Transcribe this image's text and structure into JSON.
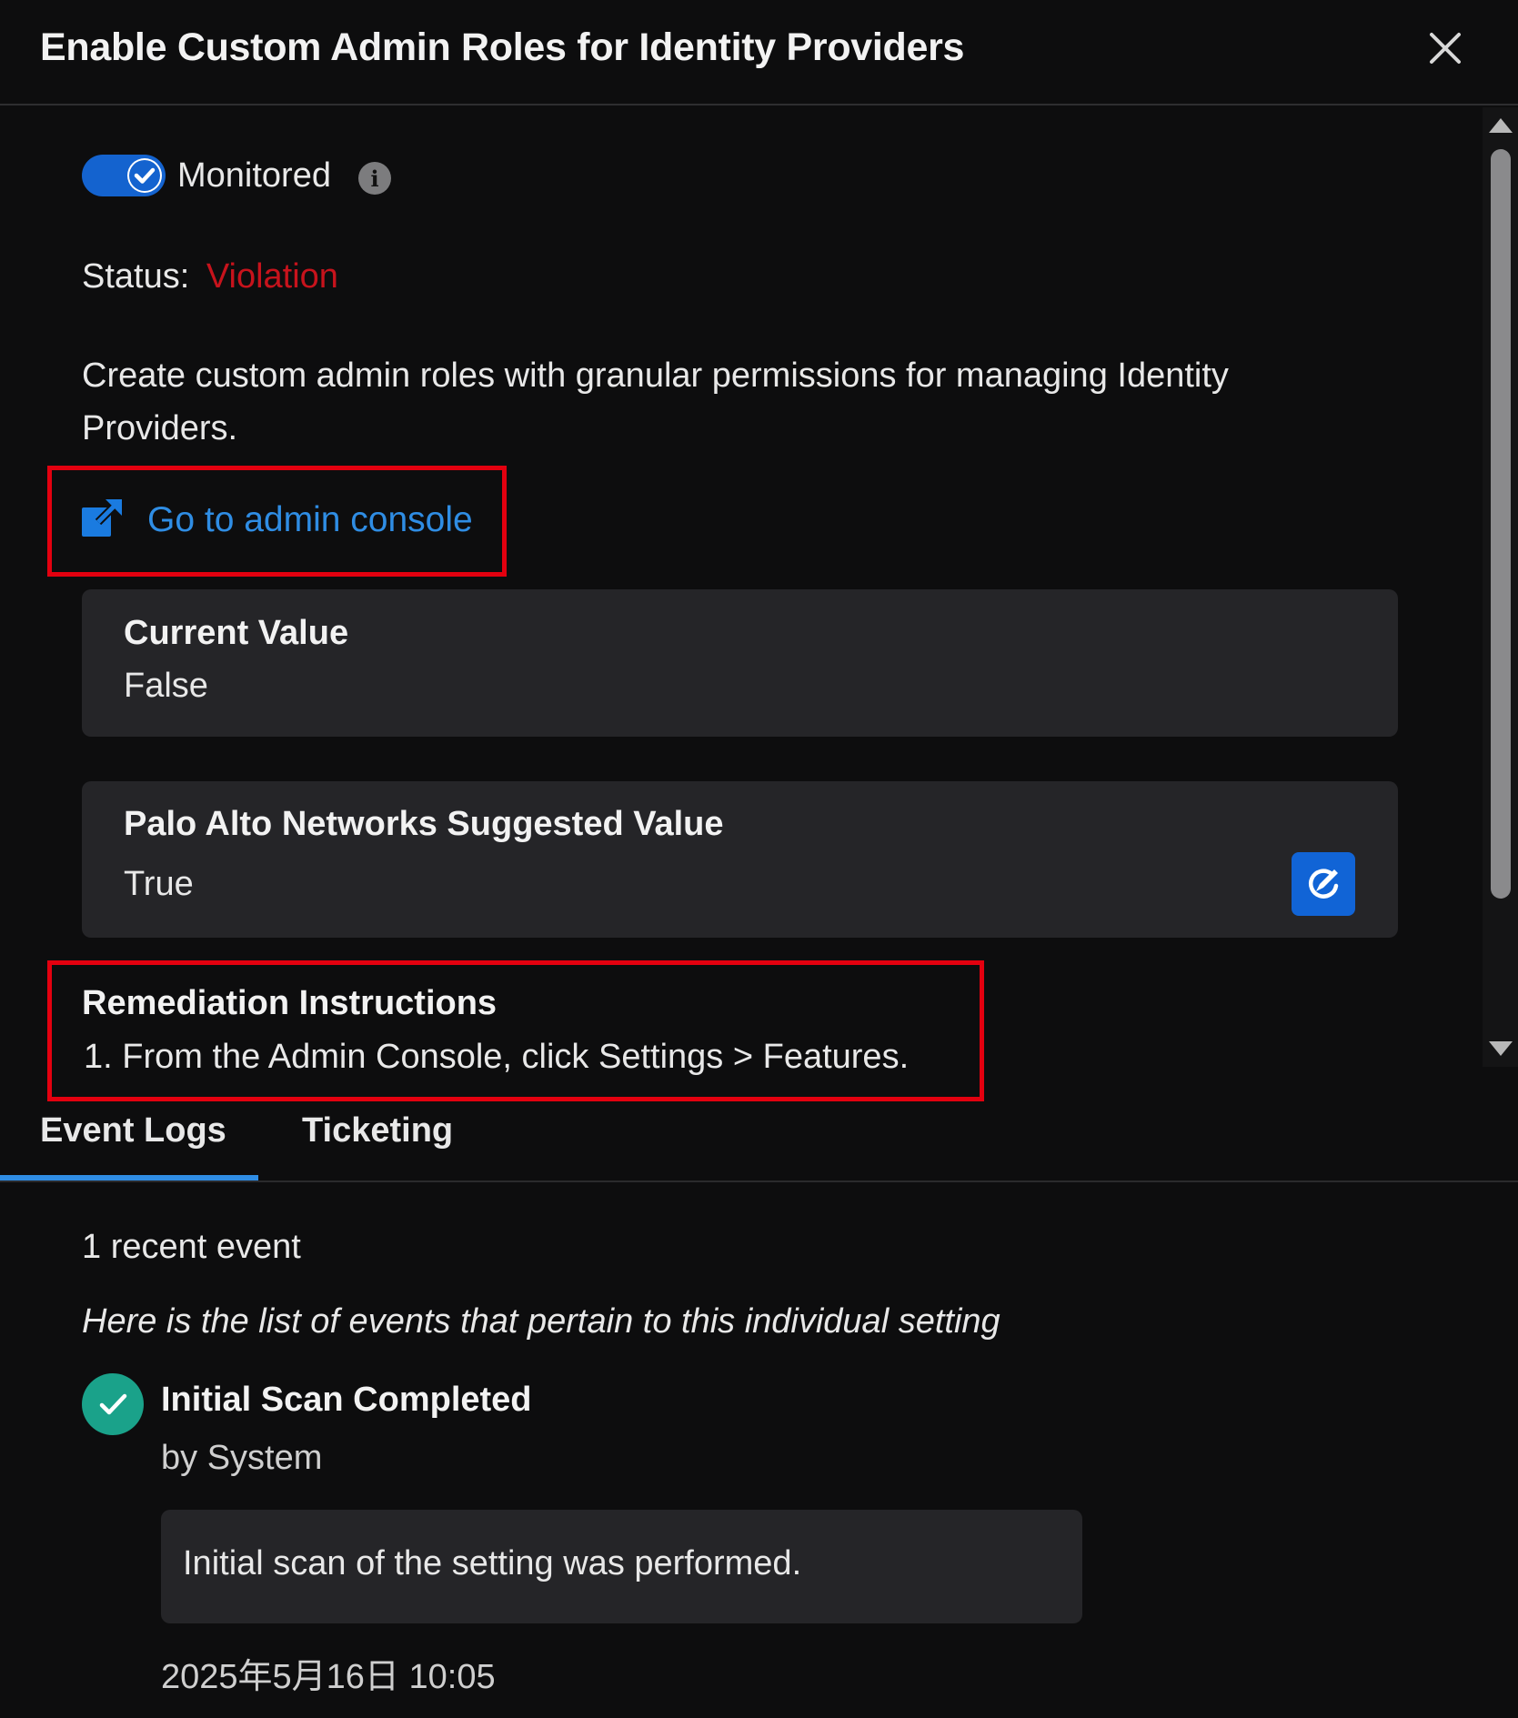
{
  "dialog": {
    "title": "Enable Custom Admin Roles for Identity Providers",
    "close_icon": "close-icon"
  },
  "monitor": {
    "toggle_on": true,
    "label": "Monitored",
    "info_icon": "info-icon"
  },
  "status": {
    "label": "Status:",
    "value": "Violation",
    "value_color": "#c7131c"
  },
  "description": "Create custom admin roles with granular permissions for managing Identity Providers.",
  "admin_link": {
    "icon": "external-link-icon",
    "label": "Go to admin console",
    "color": "#2f8de4"
  },
  "current_value": {
    "title": "Current Value",
    "value": "False"
  },
  "suggested_value": {
    "title": "Palo Alto Networks Suggested Value",
    "value": "True",
    "edit_icon": "edit-icon"
  },
  "remediation": {
    "title": "Remediation Instructions",
    "steps": [
      "1. From the Admin Console, click Settings > Features."
    ]
  },
  "tabs": [
    {
      "label": "Event Logs",
      "active": true
    },
    {
      "label": "Ticketing",
      "active": false
    }
  ],
  "events": {
    "count_text": "1 recent event",
    "description": "Here is the list of events that pertain to this individual setting",
    "items": [
      {
        "icon": "check-circle-icon",
        "title": "Initial Scan Completed",
        "by": "by System",
        "detail": "Initial scan of the setting was performed.",
        "time": "2025年5月16日 10:05"
      }
    ]
  },
  "colors": {
    "background": "#0d0d0e",
    "card": "#252528",
    "accent": "#1463cf",
    "highlight_box": "#e3000f",
    "success": "#1aa28a"
  }
}
